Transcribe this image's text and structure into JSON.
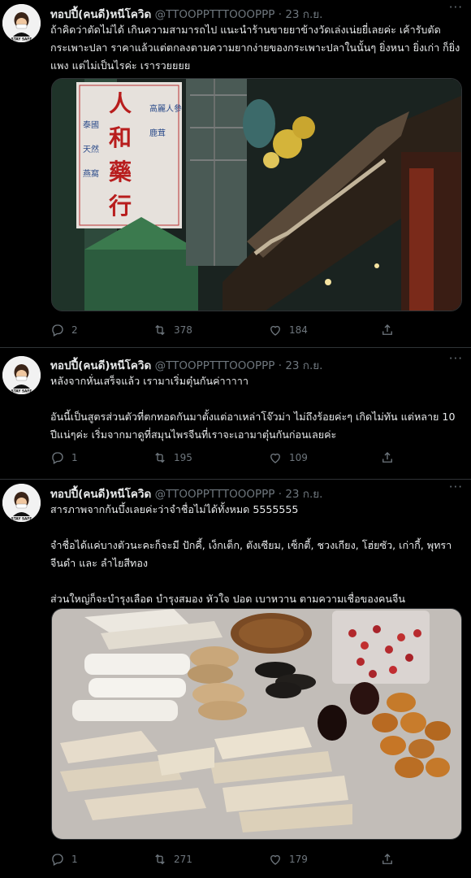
{
  "author": {
    "name": "ทอปปี้(คนดี)หนีโควิด",
    "handle": "@TTOOPPTTTOOOPPP",
    "separator": "·",
    "avatar_text": "STAY SAFE"
  },
  "tweets": [
    {
      "date": "23 ก.ย.",
      "paragraphs": [
        "ถ้าคิดว่าตัดไม่ได้ เกินความสามารถไป แนะนำร้านขายยาข้างวัดเล่งเน่ยยี่เลยค่ะ เค้ารับตัดกระเพาะปลา ราคาแล้วแต่ตกลงตามความยากง่ายของกระเพาะปลาในนั้นๆ ยิ่งหนา ยิ่งเก่า ก็ยิ่งแพง แต่ไม่เป็นไรค่ะ เรารวยยยย"
      ],
      "image_alt": "Chinese medicine shop sign",
      "sign_text": [
        "人",
        "和",
        "藥",
        "行",
        "高麗人參",
        "鹿茸",
        "泰國",
        "天然",
        "燕窩"
      ],
      "replies": "2",
      "retweets": "378",
      "likes": "184"
    },
    {
      "date": "23 ก.ย.",
      "paragraphs": [
        "หลังจากหั่นเสร็จแล้ว เรามาเริ่มตุ๋นกันค่าาาาา",
        "อันนี้เป็นสูตรส่วนตัวที่ตกทอดกันมาตั้งแต่อาเหล่าโจ๊วม่า ไม่ถึงร้อยค่ะๆ เกิดไม่ทัน แต่หลาย 10 ปีแน่ๆค่ะ เริ่มจากมาดูที่สมุนไพรจีนที่เราจะเอามาตุ๋นกันก่อนเลยค่ะ"
      ],
      "replies": "1",
      "retweets": "195",
      "likes": "109"
    },
    {
      "date": "23 ก.ย.",
      "paragraphs": [
        "สารภาพจากก้นบึ้งเลยค่ะว่าจำชื่อไม่ได้ทั้งหมด 5555555",
        "จำชื่อได้แค่บางตัวนะคะก็จะมี ปักคี้, เง็กเต็ก, ตังเซียม, เซ็กตี้, ชวงเกียง, โฮ่ยซัว, เก่ากี้, พุทราจีนดำ และ ลำไยสีทอง",
        "ส่วนใหญ่ก็จะบำรุงเลือด บำรุงสมอง หัวใจ ปอด เบาหวาน ตามความเชื่อของคนจีน"
      ],
      "image_alt": "Chinese herbs laid out on table",
      "replies": "1",
      "retweets": "271",
      "likes": "179"
    }
  ],
  "icons": {
    "reply": "reply-icon",
    "retweet": "retweet-icon",
    "like": "heart-icon",
    "share": "share-icon",
    "more": "more-icon"
  },
  "colors": {
    "background": "#000000",
    "text": "#e7e9ea",
    "muted": "#6e767d",
    "border": "#2f3336"
  }
}
